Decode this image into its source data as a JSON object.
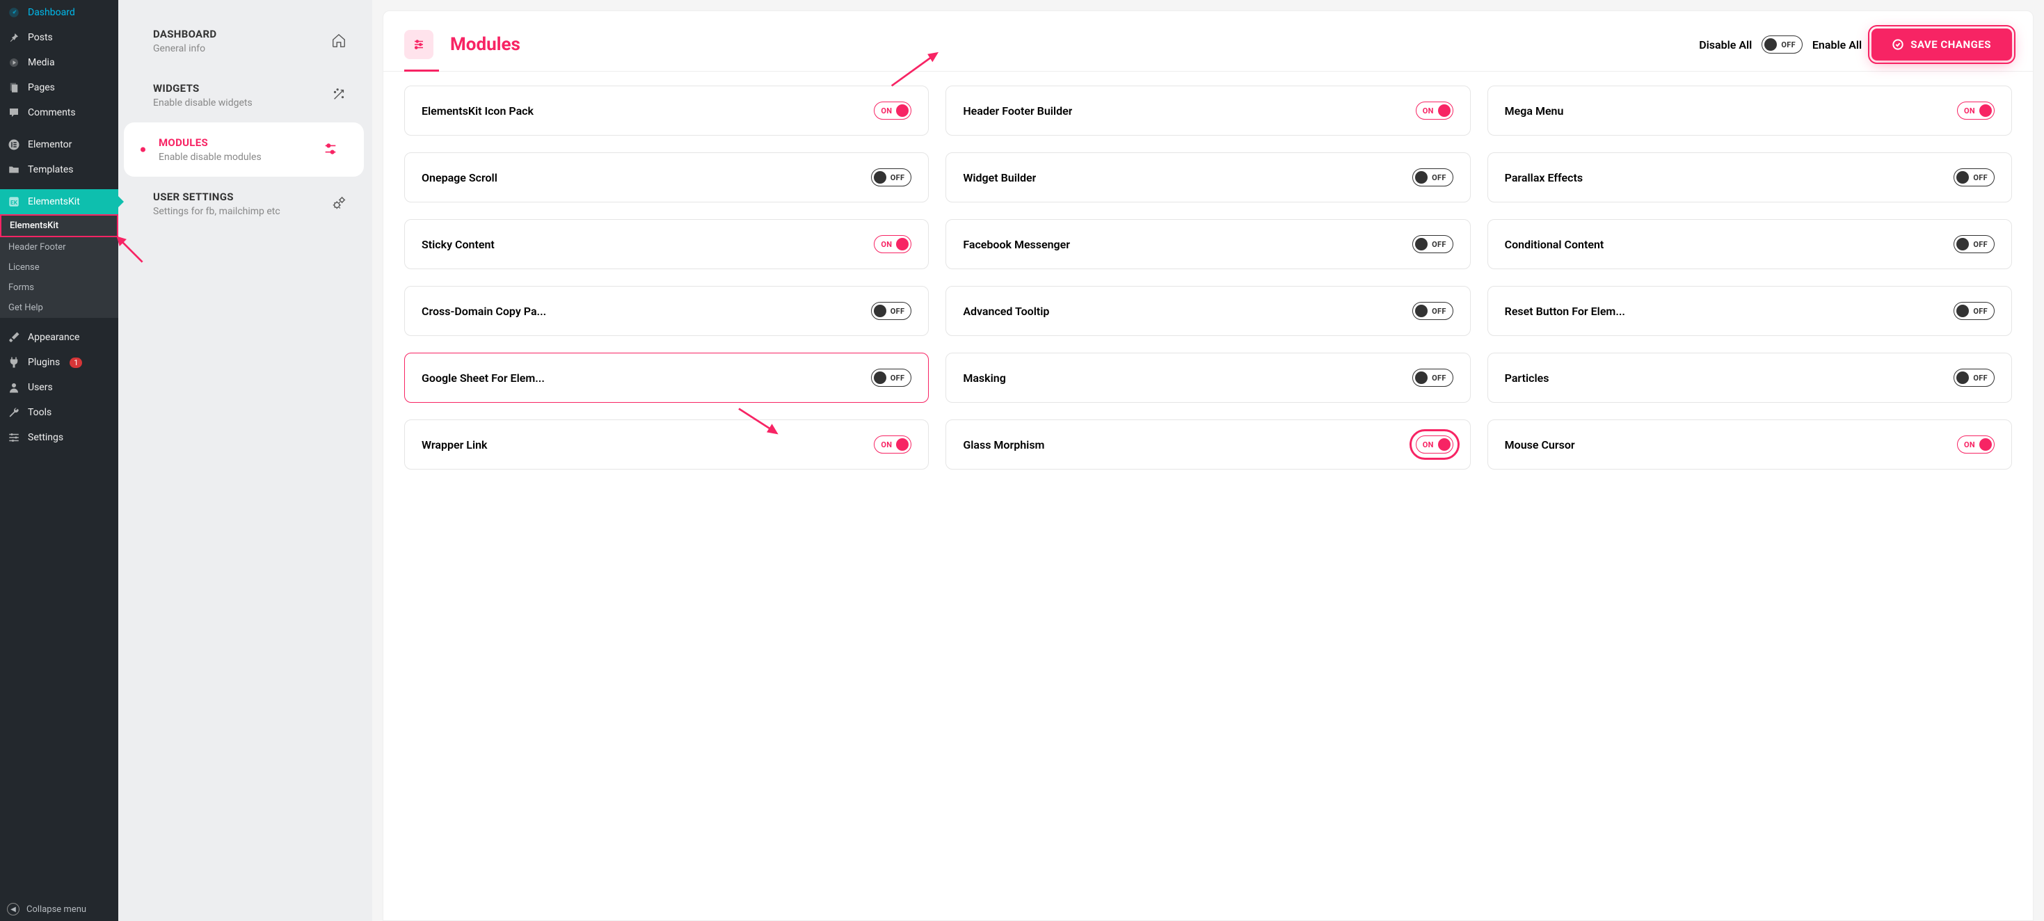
{
  "wp_menu": [
    {
      "label": "Dashboard",
      "icon": "dashboard"
    },
    {
      "label": "Posts",
      "icon": "pin"
    },
    {
      "label": "Media",
      "icon": "media"
    },
    {
      "label": "Pages",
      "icon": "pages"
    },
    {
      "label": "Comments",
      "icon": "comment"
    },
    {
      "label": "Elementor",
      "icon": "elementor"
    },
    {
      "label": "Templates",
      "icon": "folder"
    },
    {
      "label": "ElementsKit",
      "icon": "ek",
      "active": true
    },
    {
      "label": "Appearance",
      "icon": "brush"
    },
    {
      "label": "Plugins",
      "icon": "plug",
      "badge": "1"
    },
    {
      "label": "Users",
      "icon": "user"
    },
    {
      "label": "Tools",
      "icon": "wrench"
    },
    {
      "label": "Settings",
      "icon": "sliders"
    }
  ],
  "wp_submenu": [
    {
      "label": "ElementsKit",
      "active": true
    },
    {
      "label": "Header Footer"
    },
    {
      "label": "License"
    },
    {
      "label": "Forms"
    },
    {
      "label": "Get Help"
    }
  ],
  "wp_collapse_label": "Collapse menu",
  "ek_nav": [
    {
      "title": "DASHBOARD",
      "subtitle": "General info",
      "icon": "home"
    },
    {
      "title": "WIDGETS",
      "subtitle": "Enable disable widgets",
      "icon": "wand"
    },
    {
      "title": "MODULES",
      "subtitle": "Enable disable modules",
      "icon": "sliders",
      "active": true
    },
    {
      "title": "USER SETTINGS",
      "subtitle": "Settings for fb, mailchimp etc",
      "icon": "gear"
    }
  ],
  "header": {
    "title": "Modules",
    "disable_all": "Disable All",
    "enable_all": "Enable All",
    "save": "SAVE CHANGES"
  },
  "toggle_labels": {
    "on": "ON",
    "off": "OFF"
  },
  "modules": [
    {
      "name": "ElementsKit Icon Pack",
      "on": true
    },
    {
      "name": "Header Footer Builder",
      "on": true
    },
    {
      "name": "Mega Menu",
      "on": true
    },
    {
      "name": "Onepage Scroll",
      "on": false
    },
    {
      "name": "Widget Builder",
      "on": false
    },
    {
      "name": "Parallax Effects",
      "on": false
    },
    {
      "name": "Sticky Content",
      "on": true
    },
    {
      "name": "Facebook Messenger",
      "on": false
    },
    {
      "name": "Conditional Content",
      "on": false
    },
    {
      "name": "Cross-Domain Copy Pa...",
      "on": false
    },
    {
      "name": "Advanced Tooltip",
      "on": false
    },
    {
      "name": "Reset Button For Elem...",
      "on": false
    },
    {
      "name": "Google Sheet For Elem...",
      "on": false,
      "active_card": true
    },
    {
      "name": "Masking",
      "on": false
    },
    {
      "name": "Particles",
      "on": false
    },
    {
      "name": "Wrapper Link",
      "on": true
    },
    {
      "name": "Glass Morphism",
      "on": true,
      "highlighted": true
    },
    {
      "name": "Mouse Cursor",
      "on": true
    }
  ]
}
